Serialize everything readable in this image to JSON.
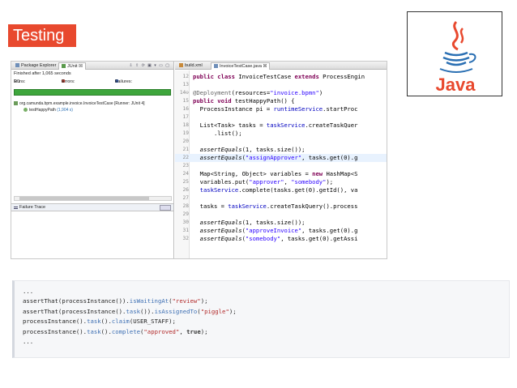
{
  "slide": {
    "title": "Testing"
  },
  "logo": {
    "text": "Java",
    "icon": "java-coffee-cup-icon",
    "colors": {
      "cup": "#2a6fb3",
      "steam": "#e8492e",
      "text": "#e8492e"
    }
  },
  "ide": {
    "left_tabs": [
      "Package Explorer",
      "JUnit"
    ],
    "left_tab_close": "☒",
    "toolbar_icons": "⇩ ⇧ ⟳ ▣ ▾ ▭ ▢",
    "finished": "Finished after 1,065 seconds",
    "runs_label": "Runs:",
    "runs_value": "1/1",
    "errors_label": "Errors:",
    "errors_value": "0",
    "failures_label": "Failures:",
    "failures_value": "0",
    "tree": [
      {
        "label": "org.camunda.bpm.example.invoice.InvoiceTestCase [Runner: JUnit 4]",
        "time": ""
      },
      {
        "label": "testHappyPath",
        "time": "(1,904 s)"
      }
    ],
    "failure_trace": "Failure Trace",
    "editor_tabs": [
      "build.xml",
      "InvoiceTestCase.java"
    ],
    "editor_tab_close": "☒",
    "code": [
      {
        "n": "12",
        "t": "public class InvoiceTestCase extends ProcessEngin"
      },
      {
        "n": "13",
        "t": ""
      },
      {
        "n": "14⊖",
        "t": "@Deployment(resources=\"invoice.bpmn\")"
      },
      {
        "n": "15",
        "t": "public void testHappyPath() {"
      },
      {
        "n": "16",
        "t": "  ProcessInstance pi = runtimeService.startProc"
      },
      {
        "n": "17",
        "t": ""
      },
      {
        "n": "18",
        "t": "  List<Task> tasks = taskService.createTaskQuer"
      },
      {
        "n": "19",
        "t": "      .list();"
      },
      {
        "n": "20",
        "t": ""
      },
      {
        "n": "21",
        "t": "  assertEquals(1, tasks.size());"
      },
      {
        "n": "22",
        "t": "  assertEquals(\"assignApprover\", tasks.get(0).g"
      },
      {
        "n": "23",
        "t": ""
      },
      {
        "n": "24",
        "t": "  Map<String, Object> variables = new HashMap<S"
      },
      {
        "n": "25",
        "t": "  variables.put(\"approver\", \"somebody\");"
      },
      {
        "n": "26",
        "t": "  taskService.complete(tasks.get(0).getId(), va"
      },
      {
        "n": "27",
        "t": ""
      },
      {
        "n": "28",
        "t": "  tasks = taskService.createTaskQuery().process"
      },
      {
        "n": "29",
        "t": ""
      },
      {
        "n": "30",
        "t": "  assertEquals(1, tasks.size());"
      },
      {
        "n": "31",
        "t": "  assertEquals(\"approveInvoice\", tasks.get(0).g"
      },
      {
        "n": "32",
        "t": "  assertEquals(\"somebody\", tasks.get(0).getAssi"
      }
    ]
  },
  "snippet": [
    "...",
    "assertThat(processInstance()).isWaitingAt(\"review\");",
    "assertThat(processInstance().task()).isAssignedTo(\"piggle\");",
    "processInstance().task().claim(USER_STAFF);",
    "processInstance().task().complete(\"approved\", true);",
    "..."
  ]
}
